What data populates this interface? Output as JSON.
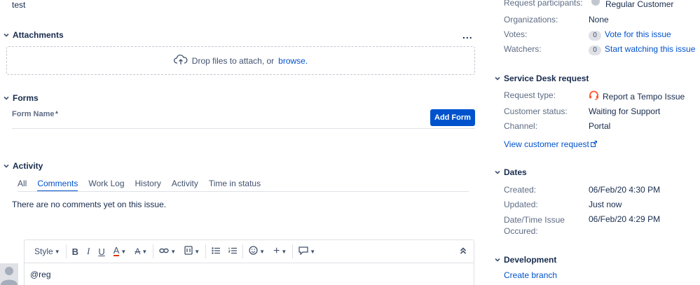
{
  "description": {
    "text": "test"
  },
  "attachments": {
    "title": "Attachments",
    "more": "...",
    "drop_text": "Drop files to attach, or",
    "browse": "browse."
  },
  "forms": {
    "title": "Forms",
    "column_header": "Form Name",
    "add_button": "Add Form"
  },
  "activity": {
    "title": "Activity",
    "tabs": [
      "All",
      "Comments",
      "Work Log",
      "History",
      "Activity",
      "Time in status"
    ],
    "active_tab": "Comments",
    "empty_text": "There are no comments yet on this issue."
  },
  "editor": {
    "style_label": "Style",
    "input_value": "@reg"
  },
  "people": {
    "participants_label": "Request participants:",
    "participants_value": "Regular Customer",
    "orgs_label": "Organizations:",
    "orgs_value": "None",
    "votes_label": "Votes:",
    "votes_count": "0",
    "votes_link": "Vote for this issue",
    "watchers_label": "Watchers:",
    "watchers_count": "0",
    "watchers_link": "Start watching this issue"
  },
  "service_desk": {
    "title": "Service Desk request",
    "type_label": "Request type:",
    "type_value": "Report a Tempo Issue",
    "status_label": "Customer status:",
    "status_value": "Waiting for Support",
    "channel_label": "Channel:",
    "channel_value": "Portal",
    "view_link": "View customer request"
  },
  "dates": {
    "title": "Dates",
    "created_label": "Created:",
    "created_value": "06/Feb/20 4:30 PM",
    "updated_label": "Updated:",
    "updated_value": "Just now",
    "datetime_label_1": "Date/Time Issue",
    "datetime_label_2": "Occured:",
    "datetime_value": "06/Feb/20 4:29 PM"
  },
  "development": {
    "title": "Development",
    "create_branch": "Create branch"
  },
  "colors": {
    "accent": "#0052cc",
    "headset": "#ff5630"
  }
}
